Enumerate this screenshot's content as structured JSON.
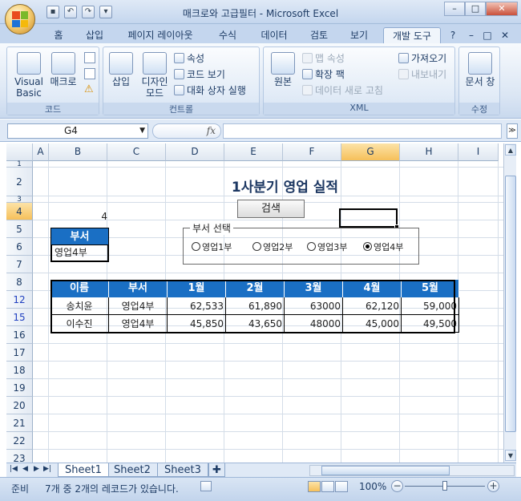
{
  "window": {
    "title": "매크로와 고급필터 - Microsoft Excel",
    "controls": [
      "–",
      "□",
      "✕"
    ]
  },
  "ribbon_tabs": [
    "홈",
    "삽입",
    "페이지 레이아웃",
    "수식",
    "데이터",
    "검토",
    "보기",
    "개발 도구"
  ],
  "ribbon_right": [
    "?",
    "–",
    "□",
    "✕"
  ],
  "ribbon": {
    "code_group": {
      "label": "코드",
      "visual_basic": "Visual Basic",
      "macro": "매크로"
    },
    "controls_group": {
      "label": "컨트롤",
      "insert": "삽입",
      "design_mode": "디자인 모드",
      "properties": "속성",
      "view_code": "코드 보기",
      "run_dialog": "대화 상자 실행"
    },
    "xml_group": {
      "label": "XML",
      "source": "원본",
      "map_properties": "맵 속성",
      "expansion_packs": "확장 팩",
      "refresh_data": "데이터 새로 고침",
      "import": "가져오기",
      "export": "내보내기"
    },
    "modify_group": {
      "label": "수정",
      "document_panel": "문서 창"
    }
  },
  "formula_bar": {
    "name_box": "G4",
    "fx": "fx",
    "formula": ""
  },
  "columns": [
    "A",
    "B",
    "C",
    "D",
    "E",
    "F",
    "G",
    "H",
    "I"
  ],
  "rows": [
    "1",
    "2",
    "3",
    "4",
    "5",
    "6",
    "7",
    "8",
    "12",
    "15",
    "16",
    "17",
    "18",
    "19",
    "20",
    "21",
    "22",
    "23"
  ],
  "selected_cell": {
    "col": "G",
    "row": "4"
  },
  "sheet": {
    "title": "1사분기 영업 실적",
    "count_value": "4",
    "search_button": "검색",
    "criteria": {
      "header": "부서",
      "value": "영업4부"
    },
    "dept_group": {
      "legend": "부서 선택",
      "options": [
        "영업1부",
        "영업2부",
        "영업3부",
        "영업4부"
      ],
      "selected": "영업4부"
    },
    "table": {
      "headers": [
        "이름",
        "부서",
        "1월",
        "2월",
        "3월",
        "4월",
        "5월"
      ],
      "rows": [
        [
          "송치윤",
          "영업4부",
          "62,533",
          "61,890",
          "63000",
          "62,120",
          "59,000"
        ],
        [
          "이수진",
          "영업4부",
          "45,850",
          "43,650",
          "48000",
          "45,000",
          "49,500"
        ]
      ]
    }
  },
  "sheet_tabs": [
    "Sheet1",
    "Sheet2",
    "Sheet3"
  ],
  "active_sheet": "Sheet1",
  "status": {
    "ready": "준비",
    "message": "7개 중 2개의 레코드가 있습니다.",
    "zoom": "100%"
  },
  "colors": {
    "header_blue": "#1a6fc4",
    "selection_orange": "#f6c05a",
    "ribbon_bg": "#dbe6f4"
  }
}
